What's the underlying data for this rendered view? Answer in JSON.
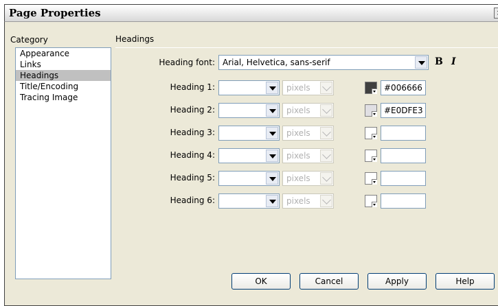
{
  "window": {
    "title": "Page Properties"
  },
  "category": {
    "header": "Category",
    "items": [
      {
        "label": "Appearance",
        "selected": false
      },
      {
        "label": "Links",
        "selected": false
      },
      {
        "label": "Headings",
        "selected": true
      },
      {
        "label": "Title/Encoding",
        "selected": false
      },
      {
        "label": "Tracing Image",
        "selected": false
      }
    ]
  },
  "section": {
    "title": "Headings"
  },
  "heading_font": {
    "label": "Heading font:",
    "value": "Arial, Helvetica, sans-serif",
    "bold_label": "B",
    "italic_label": "I"
  },
  "headings": [
    {
      "label": "Heading 1:",
      "size": "",
      "unit": "pixels",
      "color": "#006666",
      "swatch": "#404040"
    },
    {
      "label": "Heading 2:",
      "size": "",
      "unit": "pixels",
      "color": "#E0DFE3",
      "swatch": "#e0dfe3"
    },
    {
      "label": "Heading 3:",
      "size": "",
      "unit": "pixels",
      "color": "",
      "swatch": ""
    },
    {
      "label": "Heading 4:",
      "size": "",
      "unit": "pixels",
      "color": "",
      "swatch": ""
    },
    {
      "label": "Heading 5:",
      "size": "",
      "unit": "pixels",
      "color": "",
      "swatch": ""
    },
    {
      "label": "Heading 6:",
      "size": "",
      "unit": "pixels",
      "color": "",
      "swatch": ""
    }
  ],
  "buttons": {
    "ok": "OK",
    "cancel": "Cancel",
    "apply": "Apply",
    "help": "Help"
  }
}
